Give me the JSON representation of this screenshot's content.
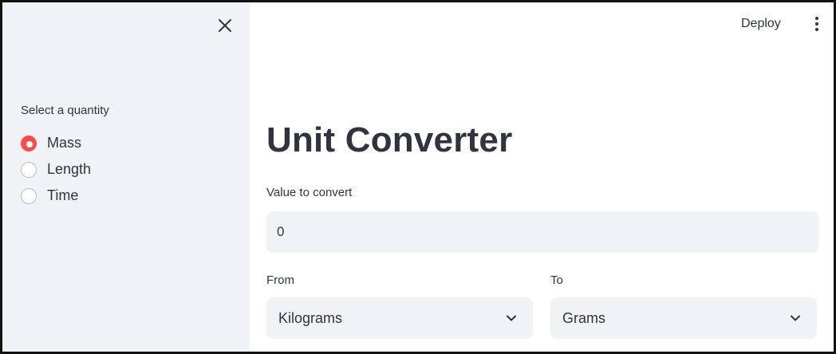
{
  "header": {
    "deploy_label": "Deploy",
    "menu_icon": "kebab-menu-icon"
  },
  "sidebar": {
    "close_icon": "close-icon",
    "radio_label": "Select a quantity",
    "options": [
      {
        "label": "Mass",
        "selected": true
      },
      {
        "label": "Length",
        "selected": false
      },
      {
        "label": "Time",
        "selected": false
      }
    ]
  },
  "main": {
    "title": "Unit Converter",
    "value_label": "Value to convert",
    "value": "0",
    "from_label": "From",
    "from_value": "Kilograms",
    "to_label": "To",
    "to_value": "Grams"
  },
  "colors": {
    "accent": "#ff4b4b",
    "sidebar_bg": "#f0f2f6",
    "text": "#31333f"
  }
}
